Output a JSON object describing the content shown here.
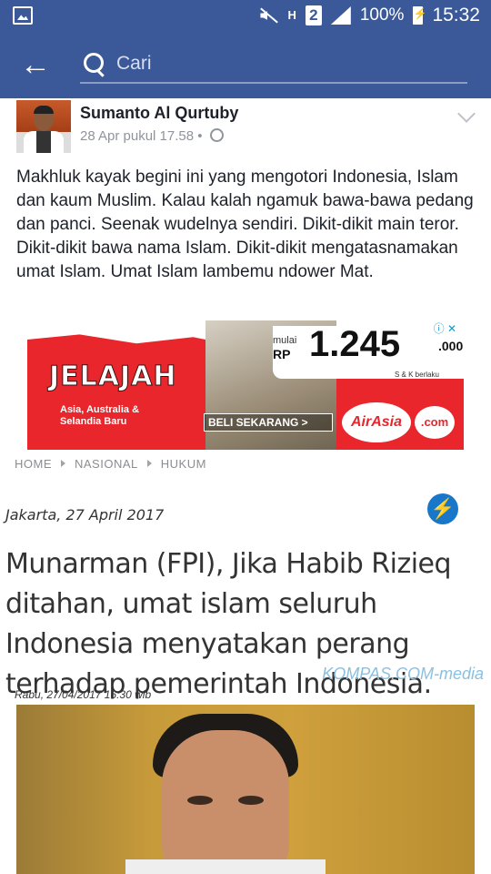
{
  "status_bar": {
    "battery": "100%",
    "time": "15:32",
    "network": "H",
    "sim": "2"
  },
  "toolbar": {
    "search_placeholder": "Cari"
  },
  "post": {
    "author": "Sumanto Al Qurtuby",
    "timestamp": "28 Apr pukul 17.58",
    "separator": "•",
    "text": "Makhluk kayak begini ini yang mengotori Indonesia, Islam dan kaum Muslim. Kalau kalah ngamuk bawa-bawa pedang dan panci. Seenak wudelnya sendiri. Dikit-dikit main teror. Dikit-dikit bawa nama Islam. Dikit-dikit mengatasnamakan umat Islam. Umat Islam lambemu ndower Mat."
  },
  "ad": {
    "title": "JELAJAH",
    "destinations": "Asia, Australia & Selandia Baru",
    "mulai": "mulai",
    "rp": "RP",
    "price": "1.245",
    "price_suffix": ".000",
    "terms": "S & K berlaku",
    "cta": "BELI SEKARANG >",
    "brand": "AirAsia",
    "brand_suffix": ".com",
    "info_icons": "ⓘ ✕"
  },
  "breadcrumb": [
    "HOME",
    "NASIONAL",
    "HUKUM"
  ],
  "news": {
    "date": "Jakarta, 27 April 2017",
    "headline": "Munarman (FPI), Jika Habib Rizieq ditahan, umat islam seluruh Indonesia menyatakan perang terhadap pemerintah Indonesia.",
    "source": "KOMPAS.COM-media",
    "photo_date": "Rabu, 27/04/2017  16:30 wib"
  },
  "colors": {
    "brand_blue": "#3b5998",
    "ad_red": "#e8262c",
    "link_blue": "#8ac0e2"
  },
  "icons": [
    "gallery-icon",
    "mute-icon",
    "signal-icon",
    "battery-icon",
    "back-arrow-icon",
    "search-icon",
    "chevron-down-icon",
    "globe-icon",
    "flash-icon"
  ]
}
